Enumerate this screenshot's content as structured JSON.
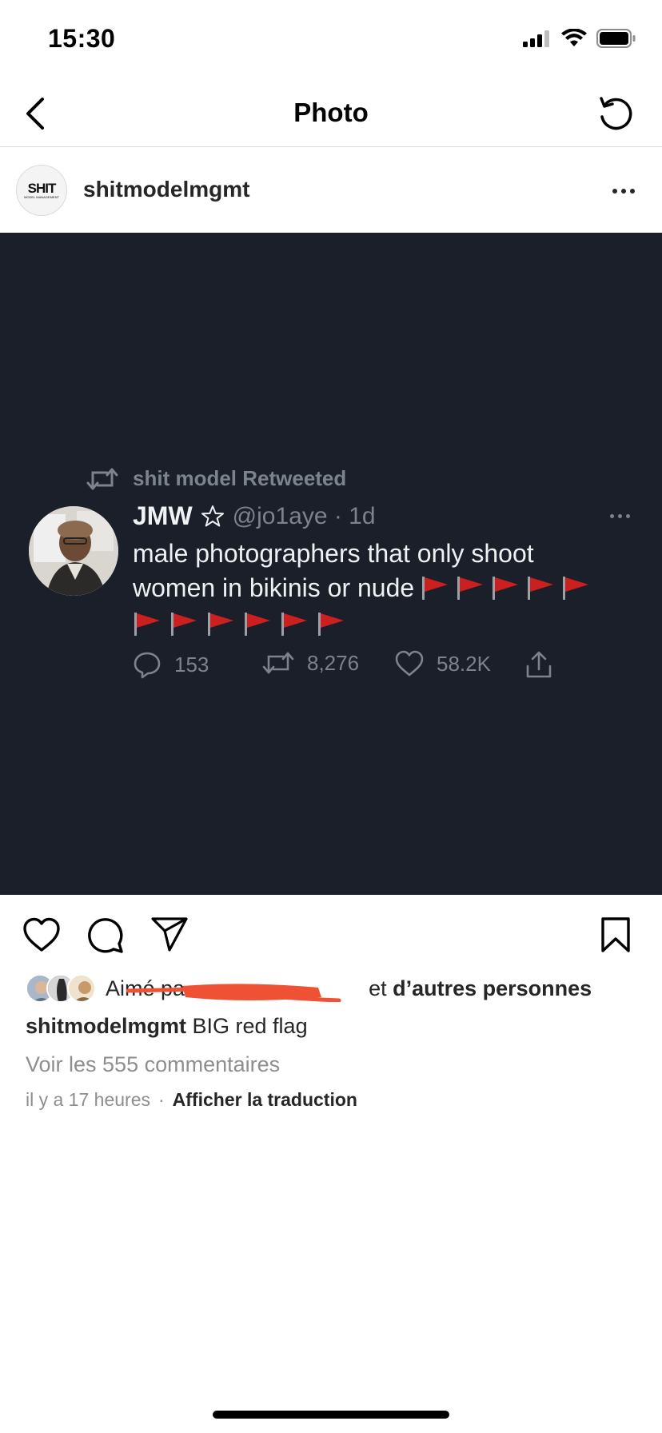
{
  "status_bar": {
    "time": "15:30"
  },
  "nav": {
    "title": "Photo"
  },
  "post": {
    "username": "shitmodelmgmt",
    "avatar_logo": "SHIT",
    "avatar_sub": "MODEL MANAGEMENT"
  },
  "tweet": {
    "retweet_text": "shit model Retweeted",
    "name": "JMW",
    "handle_time": "@jo1aye · 1d",
    "text_line1": "male photographers that only shoot",
    "text_line2": "women in bikinis or nude",
    "flags_line1_count": 5,
    "flags_line2_count": 6,
    "replies": "153",
    "retweets": "8,276",
    "likes": "58.2K"
  },
  "liked_by": {
    "prefix": "Aimé pa",
    "suffix": "et",
    "others": "d’autres personnes"
  },
  "caption": {
    "username": "shitmodelmgmt",
    "text": " BIG red flag"
  },
  "comments_link": "Voir les 555 commentaires",
  "meta": {
    "time": "il y a 17 heures",
    "separator": "·",
    "translate": "Afficher la traduction"
  },
  "colors": {
    "photo_bg": "#1a1f29",
    "redact": "#ee5133",
    "flag": "#cc1f1f"
  }
}
